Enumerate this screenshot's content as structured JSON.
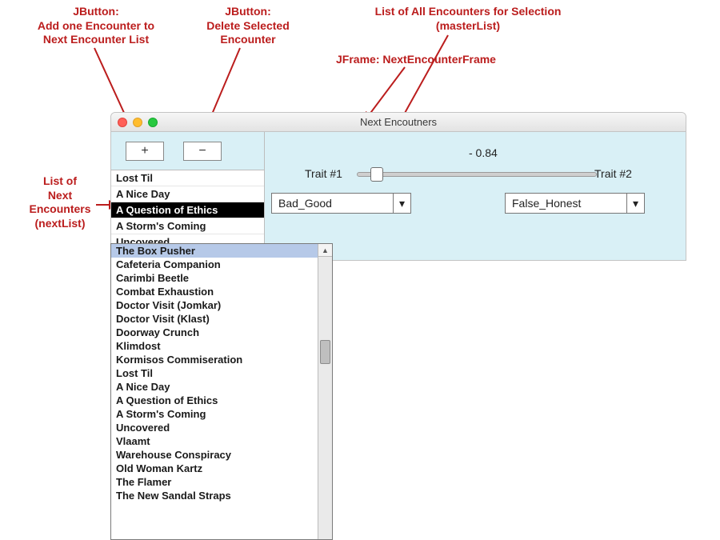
{
  "annotations": {
    "add_button": "JButton:\nAdd one Encounter to\nNext Encounter List",
    "delete_button": "JButton:\nDelete Selected\nEncounter",
    "master_list": "List of All Encounters for Selection\n(masterList)",
    "jframe": "JFrame: NextEncounterFrame",
    "next_list": "List of\nNext\nEncounters\n(nextList)"
  },
  "window": {
    "title": "Next Encoutners"
  },
  "buttons": {
    "add": "+",
    "delete": "−"
  },
  "nextList": {
    "items": [
      "Lost Til",
      "A Nice Day",
      "A Question of Ethics",
      "A Storm's Coming",
      "Uncovered"
    ],
    "selectedIndex": 2
  },
  "traits": {
    "sliderValue": "- 0.84",
    "sliderPosition": 0.08,
    "label1": "Trait #1",
    "label2": "Trait #2",
    "combo1": "Bad_Good",
    "combo2": "False_Honest"
  },
  "masterList": {
    "items": [
      "The Box Pusher",
      "Cafeteria Companion",
      "Carimbi Beetle",
      "Combat Exhaustion",
      "Doctor Visit (Jomkar)",
      "Doctor Visit (Klast)",
      "Doorway Crunch",
      "Klimdost",
      "Kormisos Commiseration",
      "Lost Til",
      "A Nice Day",
      "A Question of Ethics",
      "A Storm's Coming",
      "Uncovered",
      "Vlaamt",
      "Warehouse Conspiracy",
      "Old Woman Kartz",
      "The Flamer",
      "The New Sandal Straps"
    ],
    "selectedIndex": 0
  }
}
